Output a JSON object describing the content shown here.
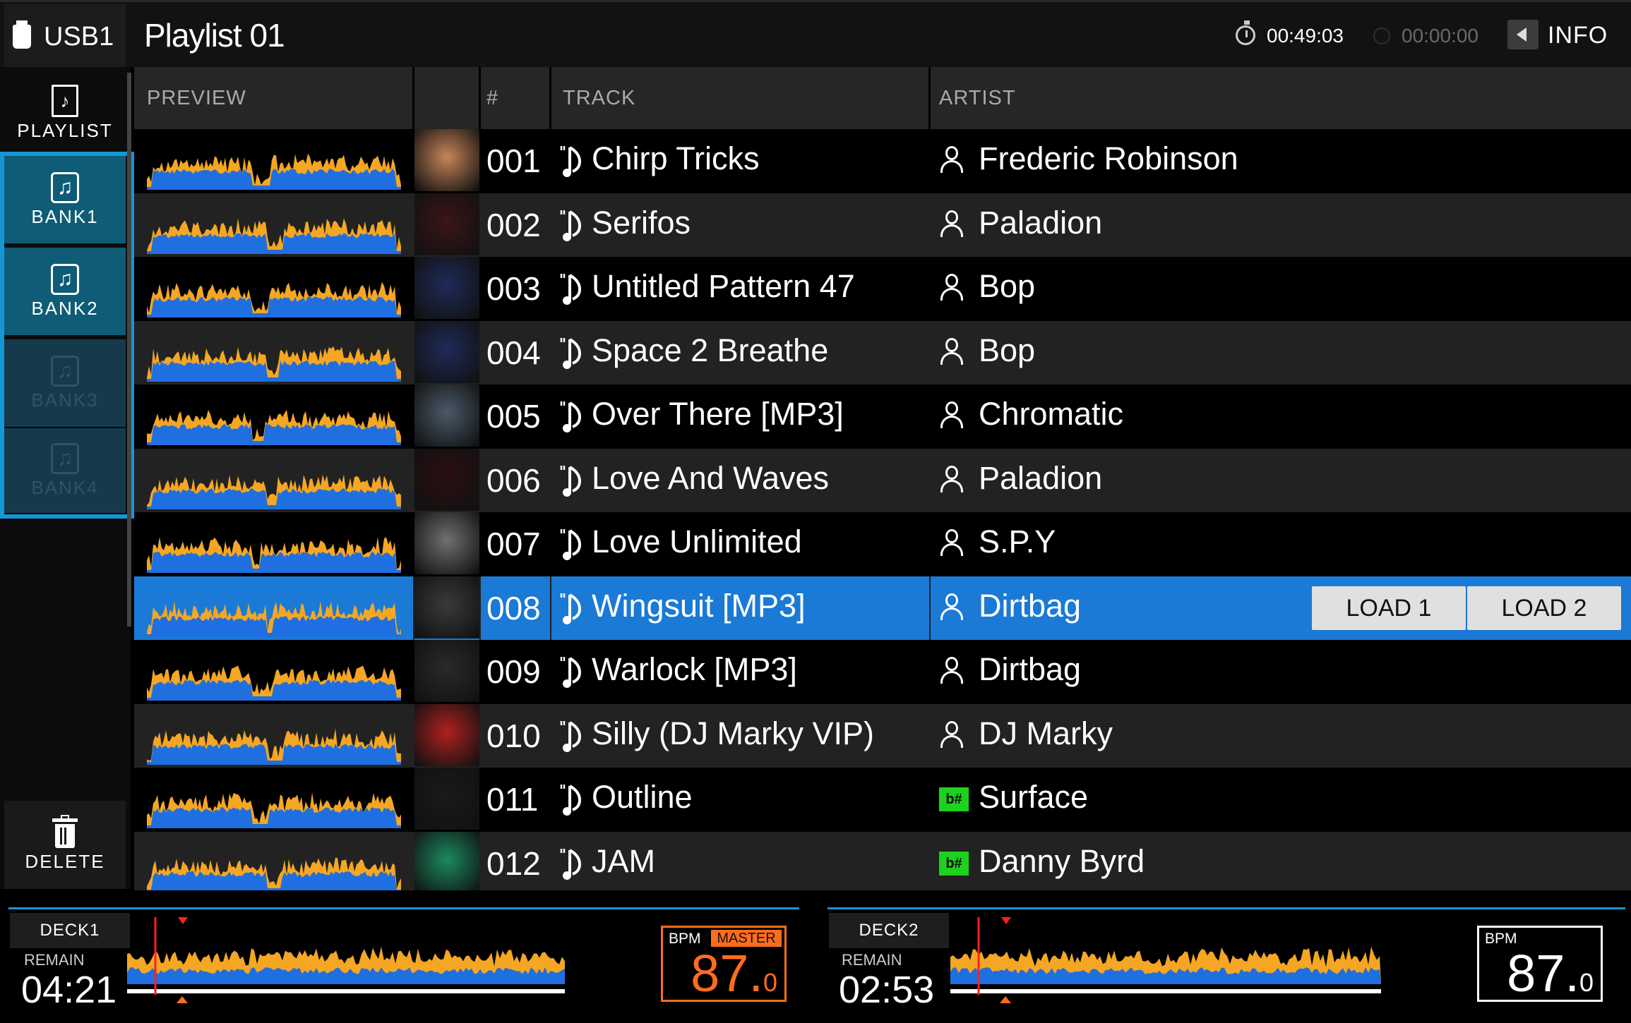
{
  "topbar": {
    "source": "USB1",
    "playlist_title": "Playlist 01",
    "elapsed_time": "00:49:03",
    "rec_time": "00:00:00",
    "info_label": "INFO"
  },
  "sidebar": {
    "playlist_label": "PLAYLIST",
    "banks": [
      {
        "label": "BANK1",
        "active": true
      },
      {
        "label": "BANK2",
        "active": true
      },
      {
        "label": "BANK3",
        "active": false
      },
      {
        "label": "BANK4",
        "active": false
      }
    ],
    "delete_label": "DELETE"
  },
  "table": {
    "headers": {
      "preview": "PREVIEW",
      "num": "#",
      "track": "TRACK",
      "artist": "ARTIST"
    },
    "rows": [
      {
        "num": "001",
        "track": "Chirp Tricks",
        "artist": "Frederic Robinson",
        "artist_icon": "user-icon"
      },
      {
        "num": "002",
        "track": "Serifos",
        "artist": "Paladion",
        "artist_icon": "user-icon"
      },
      {
        "num": "003",
        "track": "Untitled Pattern 47",
        "artist": "Bop",
        "artist_icon": "user-icon"
      },
      {
        "num": "004",
        "track": "Space 2 Breathe",
        "artist": "Bop",
        "artist_icon": "user-icon"
      },
      {
        "num": "005",
        "track": "Over There [MP3]",
        "artist": "Chromatic",
        "artist_icon": "user-icon"
      },
      {
        "num": "006",
        "track": "Love And Waves",
        "artist": "Paladion",
        "artist_icon": "user-icon"
      },
      {
        "num": "007",
        "track": "Love Unlimited",
        "artist": "S.P.Y",
        "artist_icon": "user-icon"
      },
      {
        "num": "008",
        "track": "Wingsuit [MP3]",
        "artist": "Dirtbag",
        "artist_icon": "user-icon",
        "selected": true
      },
      {
        "num": "009",
        "track": "Warlock [MP3]",
        "artist": "Dirtbag",
        "artist_icon": "user-icon"
      },
      {
        "num": "010",
        "track": "Silly (DJ Marky VIP)",
        "artist": "DJ Marky",
        "artist_icon": "user-icon"
      },
      {
        "num": "011",
        "track": "Outline",
        "artist": "Surface",
        "artist_icon": "label-icon"
      },
      {
        "num": "012",
        "track": "JAM",
        "artist": "Danny Byrd",
        "artist_icon": "label-icon"
      }
    ],
    "load_buttons": [
      "LOAD 1",
      "LOAD 2"
    ],
    "label_icon_text": "b#"
  },
  "decks": [
    {
      "tag": "DECK1",
      "remain_label": "REMAIN",
      "remain_time": "04:21",
      "bpm_label": "BPM",
      "master_label": "MASTER",
      "bpm_int": "87.",
      "bpm_dec": "0",
      "master": true
    },
    {
      "tag": "DECK2",
      "remain_label": "REMAIN",
      "remain_time": "02:53",
      "bpm_label": "BPM",
      "master_label": "",
      "bpm_int": "87.",
      "bpm_dec": "0",
      "master": false
    }
  ],
  "colors": {
    "accent": "#1597d6",
    "selected_row": "#1a7ad6",
    "wave_blue": "#1f6fe0",
    "wave_orange": "#f5a623",
    "master": "#ff6d1c",
    "label_green": "#1cd21c"
  }
}
